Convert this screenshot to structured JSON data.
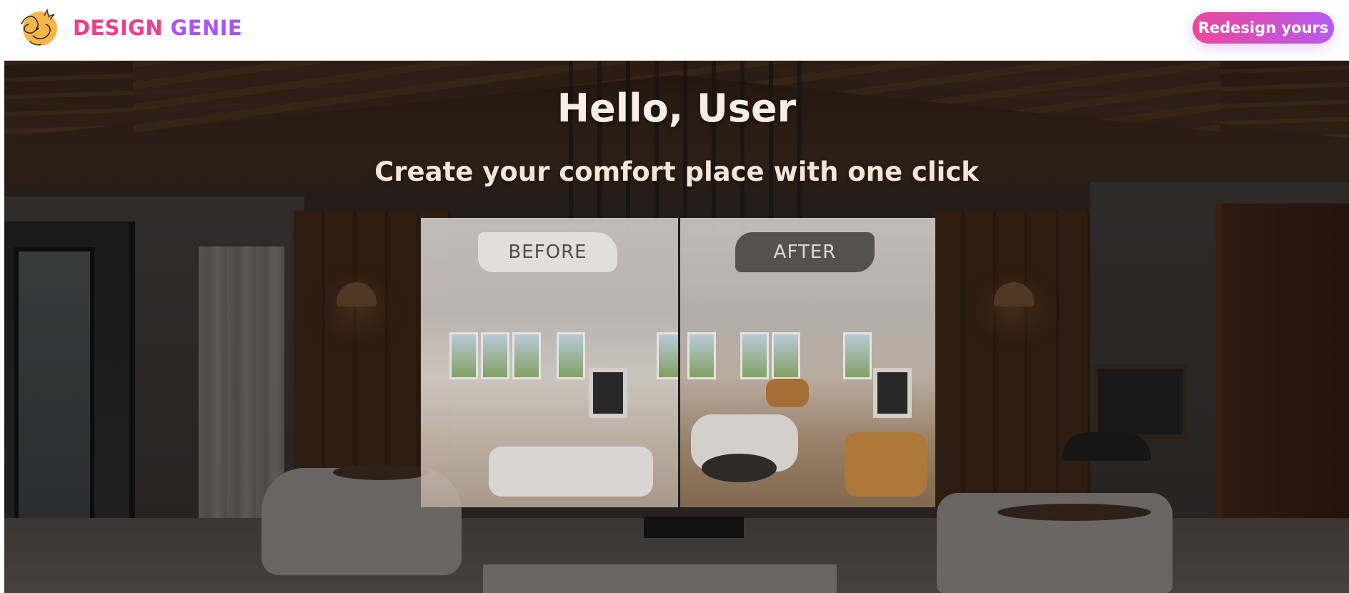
{
  "brand": {
    "word1": "DESIGN",
    "word2": "GENIE",
    "logo_icon": "genie-lamp-logo-icon",
    "colors": {
      "pink": "#ee3f8e",
      "purple": "#a855f7"
    }
  },
  "header": {
    "cta_label": "Redesign yours"
  },
  "hero": {
    "title": "Hello, User",
    "subtitle": "Create your comfort place with one click"
  },
  "compare": {
    "before_label": "BEFORE",
    "after_label": "AFTER"
  }
}
